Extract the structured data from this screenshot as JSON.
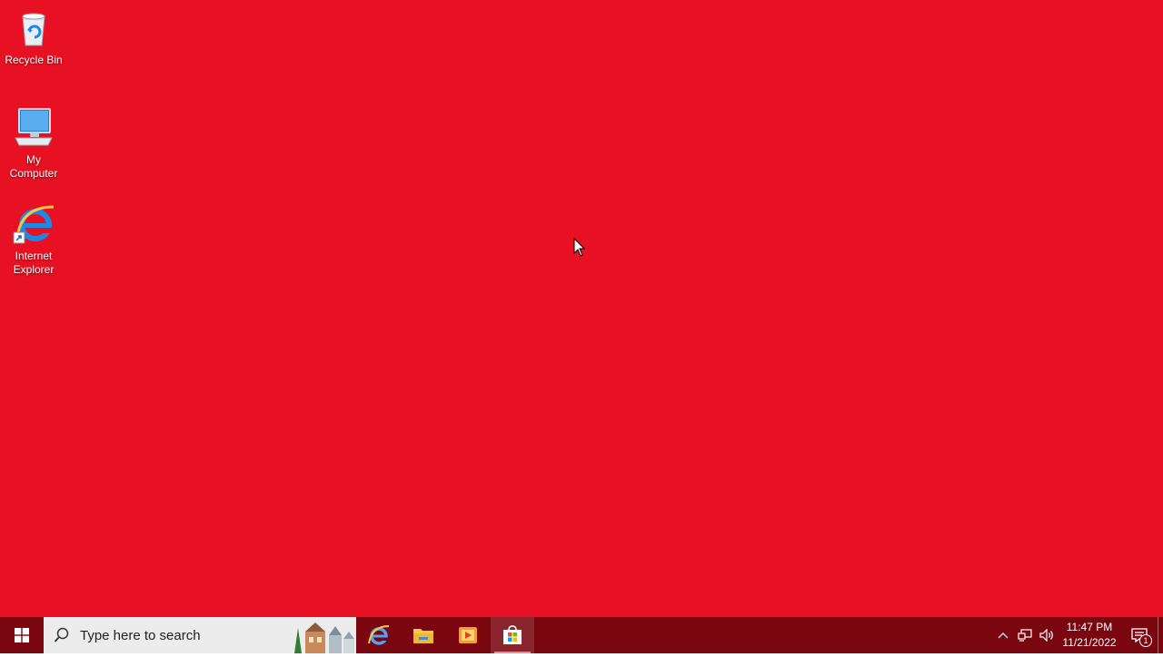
{
  "desktop": {
    "background_color": "#e81123",
    "icons": [
      {
        "label": "Recycle Bin",
        "icon": "recycle-bin-icon"
      },
      {
        "label": "My Computer",
        "icon": "computer-icon"
      },
      {
        "label": "Internet Explorer",
        "icon": "internet-explorer-icon"
      }
    ]
  },
  "taskbar": {
    "background_color": "#7a0610",
    "start_icon": "windows-logo-icon",
    "search": {
      "placeholder": "Type here to search",
      "icon": "search-icon"
    },
    "apps": [
      {
        "icon": "internet-explorer-icon",
        "active": false
      },
      {
        "icon": "file-explorer-icon",
        "active": false
      },
      {
        "icon": "media-player-icon",
        "active": false
      },
      {
        "icon": "microsoft-store-icon",
        "active": true
      }
    ],
    "tray": {
      "chevron_icon": "chevron-up-icon",
      "network_icon": "network-icon",
      "volume_icon": "volume-icon",
      "time": "11:47 PM",
      "date": "11/21/2022",
      "notification_icon": "action-center-icon",
      "notification_count": "1"
    }
  }
}
